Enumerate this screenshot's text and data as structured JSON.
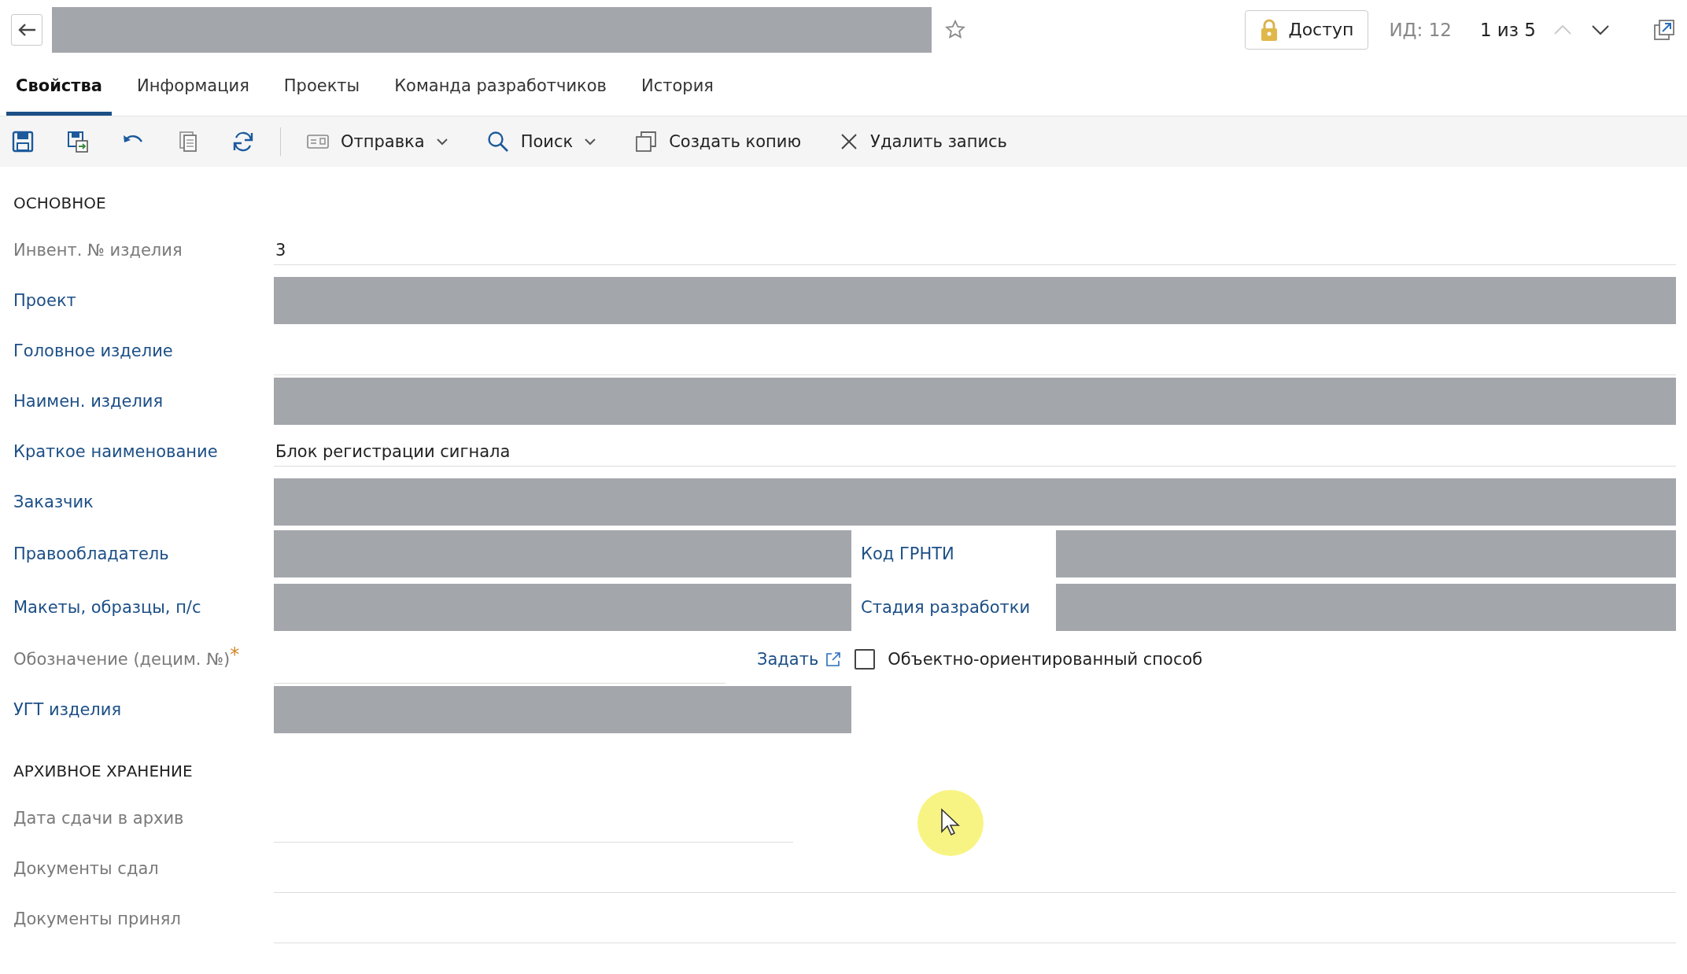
{
  "header": {
    "access_button": "Доступ",
    "id_label": "ИД: 12",
    "pager": "1 из 5"
  },
  "tabs": [
    {
      "label": "Свойства",
      "selected": true
    },
    {
      "label": "Информация",
      "selected": false
    },
    {
      "label": "Проекты",
      "selected": false
    },
    {
      "label": "Команда разработчиков",
      "selected": false
    },
    {
      "label": "История",
      "selected": false
    }
  ],
  "toolbar": [
    {
      "label": "Отправка",
      "dropdown": true
    },
    {
      "label": "Поиск",
      "dropdown": true
    },
    {
      "label": "Создать копию",
      "dropdown": false
    },
    {
      "label": "Удалить запись",
      "dropdown": false
    }
  ],
  "sections": [
    {
      "title": "ОСНОВНОЕ",
      "fields": [
        {
          "label": "Инвент. № изделия",
          "link": false,
          "kind": "text",
          "value": "3"
        },
        {
          "label": "Проект",
          "link": true,
          "kind": "redacted"
        },
        {
          "label": "Головное изделие",
          "link": true,
          "kind": "empty"
        },
        {
          "label": "Наимен. изделия",
          "link": true,
          "kind": "redacted"
        },
        {
          "label": "Краткое наименование",
          "link": true,
          "kind": "text",
          "value": "Блок регистрации сигнала"
        },
        {
          "label": "Заказчик",
          "link": true,
          "kind": "redacted"
        },
        {
          "label": "Правообладатель",
          "link": true,
          "kind": "pair",
          "second_label": "Код ГРНТИ"
        },
        {
          "label": "Макеты, образцы, п/с",
          "link": true,
          "kind": "pair",
          "second_label": "Стадия разработки"
        },
        {
          "label": "Обозначение (децим. №)",
          "link": false,
          "kind": "designation",
          "required_mark": "*",
          "action": "Задать",
          "checkbox_label": "Объектно-ориентированный способ",
          "checked": false
        },
        {
          "label": "УГТ изделия",
          "link": true,
          "kind": "half_redacted"
        }
      ]
    },
    {
      "title": "АРХИВНОЕ ХРАНЕНИЕ",
      "fields": [
        {
          "label": "Дата сдачи в архив",
          "link": false,
          "kind": "short_empty"
        },
        {
          "label": "Документы сдал",
          "link": false,
          "kind": "empty"
        },
        {
          "label": "Документы принял",
          "link": false,
          "kind": "empty"
        }
      ]
    }
  ]
}
